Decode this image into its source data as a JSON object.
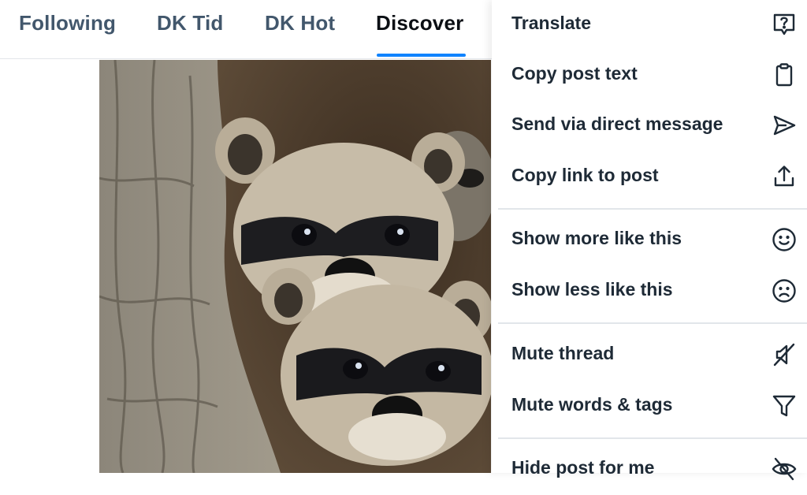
{
  "tabs": [
    {
      "label": "Following",
      "active": false
    },
    {
      "label": "DK Tid",
      "active": false
    },
    {
      "label": "DK Hot",
      "active": false
    },
    {
      "label": "Discover",
      "active": true
    }
  ],
  "post": {
    "image_subject": "two baby raccoons peeking out of a tree hollow"
  },
  "menu": {
    "items": [
      {
        "label": "Translate",
        "icon": "translate-icon"
      },
      {
        "label": "Copy post text",
        "icon": "clipboard-icon"
      },
      {
        "label": "Send via direct message",
        "icon": "send-icon"
      },
      {
        "label": "Copy link to post",
        "icon": "share-icon"
      },
      {
        "label": "Show more like this",
        "icon": "smile-icon"
      },
      {
        "label": "Show less like this",
        "icon": "frown-icon"
      },
      {
        "label": "Mute thread",
        "icon": "mute-icon"
      },
      {
        "label": "Mute words & tags",
        "icon": "filter-icon"
      },
      {
        "label": "Hide post for me",
        "icon": "eye-slash-icon"
      }
    ]
  },
  "colors": {
    "accent": "#1083fe",
    "tab_text": "#42576c",
    "menu_text": "#1e2a36"
  }
}
